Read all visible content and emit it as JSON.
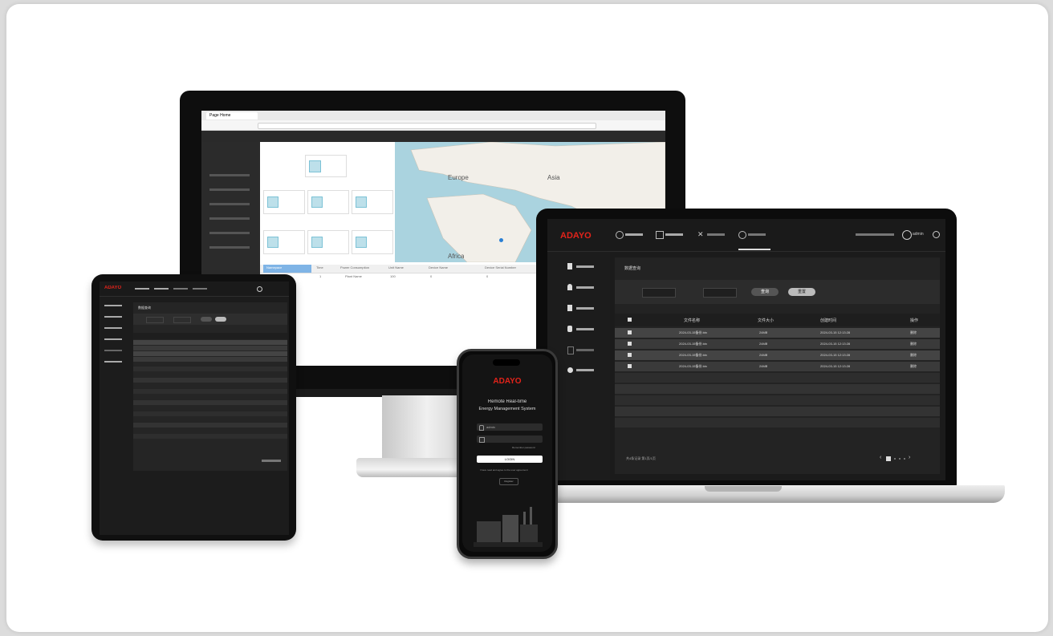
{
  "brand": "ADAYO",
  "monitor": {
    "browser_tab": "Page Home",
    "map_labels": [
      "Europe",
      "Asia",
      "Africa"
    ],
    "table_headers": [
      "Namepace",
      "Time",
      "Power Consumption",
      "Unit Name",
      "Device Name",
      "Device Serial Number",
      "Generation"
    ],
    "table_row": [
      "1",
      "Plant Name",
      "100",
      "0",
      "0"
    ]
  },
  "laptop": {
    "user": "admin",
    "page_title": "数据查询",
    "buttons": [
      "查询",
      "重置"
    ],
    "table_headers": [
      "文件名称",
      "文件大小",
      "创建时间",
      "操作"
    ],
    "rows": [
      {
        "name": "2024-03-15备份.bin",
        "size": "24MB",
        "time": "2024-03-15 12:13:28",
        "op": "删除"
      },
      {
        "name": "2024-03-15备份.bin",
        "size": "24MB",
        "time": "2024-03-15 12:13:28",
        "op": "删除"
      },
      {
        "name": "2024-03-15备份.bin",
        "size": "24MB",
        "time": "2024-03-15 12:13:28",
        "op": "删除"
      },
      {
        "name": "2024-03-15备份.bin",
        "size": "24MB",
        "time": "2024-03-15 12:13:28",
        "op": "删除"
      }
    ],
    "footer_info": "共4条记录  第1页/1页"
  },
  "tablet": {
    "page_title": "数据查询"
  },
  "phone": {
    "title_line1": "Remote Real-time",
    "title_line2": "Energy Management System",
    "username_placeholder": "admin",
    "remember": "Remember password",
    "login_button": "LOGIN",
    "agreement": "I have read and agree to the user agreement",
    "register": "Register"
  },
  "colors": {
    "accent": "#e2231a",
    "dark": "#1b1b1b"
  }
}
